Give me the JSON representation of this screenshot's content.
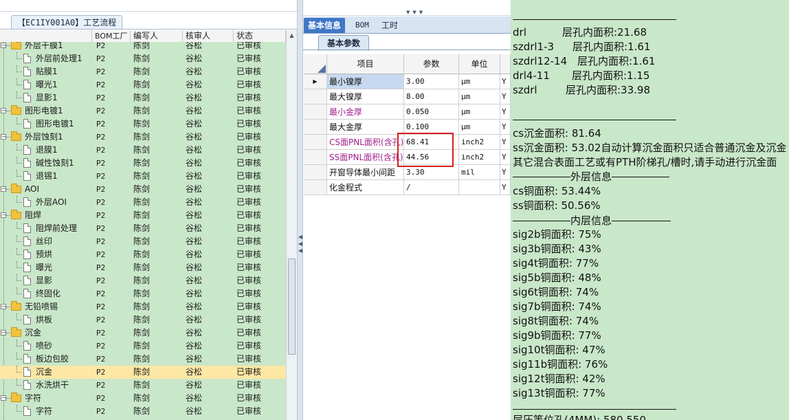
{
  "left_panel": {
    "tab_title": "【EC1IY001A0】工艺流程",
    "headers": {
      "bom": "BOM工厂",
      "writer": "编写人",
      "reviewer": "核审人",
      "status": "状态"
    },
    "rows": [
      {
        "kind": "group",
        "name": "外层干膜1",
        "bom": "P2",
        "writer": "陈剑",
        "reviewer": "谷松",
        "status": "已审核"
      },
      {
        "kind": "leaf",
        "name": "外层前处理1",
        "bom": "P2",
        "writer": "陈剑",
        "reviewer": "谷松",
        "status": "已审核"
      },
      {
        "kind": "leaf",
        "name": "贴膜1",
        "bom": "P2",
        "writer": "陈剑",
        "reviewer": "谷松",
        "status": "已审核"
      },
      {
        "kind": "leaf",
        "name": "曝光1",
        "bom": "P2",
        "writer": "陈剑",
        "reviewer": "谷松",
        "status": "已审核"
      },
      {
        "kind": "leaf",
        "name": "显影1",
        "bom": "P2",
        "writer": "陈剑",
        "reviewer": "谷松",
        "status": "已审核"
      },
      {
        "kind": "group",
        "name": "图形电镀1",
        "bom": "P2",
        "writer": "陈剑",
        "reviewer": "谷松",
        "status": "已审核"
      },
      {
        "kind": "leaf",
        "name": "图形电镀1",
        "bom": "P2",
        "writer": "陈剑",
        "reviewer": "谷松",
        "status": "已审核"
      },
      {
        "kind": "group",
        "name": "外层蚀刻1",
        "bom": "P2",
        "writer": "陈剑",
        "reviewer": "谷松",
        "status": "已审核"
      },
      {
        "kind": "leaf",
        "name": "退膜1",
        "bom": "P2",
        "writer": "陈剑",
        "reviewer": "谷松",
        "status": "已审核"
      },
      {
        "kind": "leaf",
        "name": "碱性蚀刻1",
        "bom": "P2",
        "writer": "陈剑",
        "reviewer": "谷松",
        "status": "已审核"
      },
      {
        "kind": "leaf",
        "name": "退锡1",
        "bom": "P2",
        "writer": "陈剑",
        "reviewer": "谷松",
        "status": "已审核"
      },
      {
        "kind": "group",
        "name": "AOI",
        "bom": "P2",
        "writer": "陈剑",
        "reviewer": "谷松",
        "status": "已审核"
      },
      {
        "kind": "leaf",
        "name": "外层AOI",
        "bom": "P2",
        "writer": "陈剑",
        "reviewer": "谷松",
        "status": "已审核"
      },
      {
        "kind": "group",
        "name": "阻焊",
        "bom": "P2",
        "writer": "陈剑",
        "reviewer": "谷松",
        "status": "已审核"
      },
      {
        "kind": "leaf",
        "name": "阻焊前处理",
        "bom": "P2",
        "writer": "陈剑",
        "reviewer": "谷松",
        "status": "已审核"
      },
      {
        "kind": "leaf",
        "name": "丝印",
        "bom": "P2",
        "writer": "陈剑",
        "reviewer": "谷松",
        "status": "已审核"
      },
      {
        "kind": "leaf",
        "name": "预烘",
        "bom": "P2",
        "writer": "陈剑",
        "reviewer": "谷松",
        "status": "已审核"
      },
      {
        "kind": "leaf",
        "name": "曝光",
        "bom": "P2",
        "writer": "陈剑",
        "reviewer": "谷松",
        "status": "已审核"
      },
      {
        "kind": "leaf",
        "name": "显影",
        "bom": "P2",
        "writer": "陈剑",
        "reviewer": "谷松",
        "status": "已审核"
      },
      {
        "kind": "leaf",
        "name": "终固化",
        "bom": "P2",
        "writer": "陈剑",
        "reviewer": "谷松",
        "status": "已审核"
      },
      {
        "kind": "group",
        "name": "无铅喷锡",
        "bom": "P2",
        "writer": "陈剑",
        "reviewer": "谷松",
        "status": "已审核"
      },
      {
        "kind": "leaf",
        "name": "烘板",
        "bom": "P2",
        "writer": "陈剑",
        "reviewer": "谷松",
        "status": "已审核"
      },
      {
        "kind": "group",
        "name": "沉金",
        "bom": "P2",
        "writer": "陈剑",
        "reviewer": "谷松",
        "status": "已审核"
      },
      {
        "kind": "leaf",
        "name": "喷砂",
        "bom": "P2",
        "writer": "陈剑",
        "reviewer": "谷松",
        "status": "已审核"
      },
      {
        "kind": "leaf",
        "name": "板边包胶",
        "bom": "P2",
        "writer": "陈剑",
        "reviewer": "谷松",
        "status": "已审核"
      },
      {
        "kind": "leaf",
        "name": "沉金",
        "bom": "P2",
        "writer": "陈剑",
        "reviewer": "谷松",
        "status": "已审核",
        "selected": true
      },
      {
        "kind": "leaf",
        "name": "水洗烘干",
        "bom": "P2",
        "writer": "陈剑",
        "reviewer": "谷松",
        "status": "已审核"
      },
      {
        "kind": "group",
        "name": "字符",
        "bom": "P2",
        "writer": "陈剑",
        "reviewer": "谷松",
        "status": "已审核"
      },
      {
        "kind": "leaf",
        "name": "字符",
        "bom": "P2",
        "writer": "陈剑",
        "reviewer": "谷松",
        "status": "已审核"
      }
    ]
  },
  "mid_panel": {
    "tabs": [
      "基本信息",
      "BOM",
      "工时"
    ],
    "sub_tab": "基本参数",
    "headers": {
      "item": "项目",
      "param": "参数",
      "unit": "单位"
    },
    "rows": [
      {
        "name": "最小镍厚",
        "value": "3.00",
        "unit": "μm",
        "last": "Y",
        "style": "hl",
        "current": true
      },
      {
        "name": "最大镍厚",
        "value": "8.00",
        "unit": "μm",
        "last": "Y",
        "style": ""
      },
      {
        "name": "最小金厚",
        "value": "0.050",
        "unit": "μm",
        "last": "Y",
        "style": "pink"
      },
      {
        "name": "最大金厚",
        "value": "0.100",
        "unit": "μm",
        "last": "Y",
        "style": ""
      },
      {
        "name": "CS面PNL面积(含孔)",
        "value": "68.41",
        "unit": "inch2",
        "last": "Y",
        "style": "pink"
      },
      {
        "name": "SS面PNL面积(含孔)",
        "value": "44.56",
        "unit": "inch2",
        "last": "Y",
        "style": "pink"
      },
      {
        "name": "开窗导体最小间距",
        "value": "3.30",
        "unit": "mil",
        "last": "Y",
        "style": ""
      },
      {
        "name": "化金程式",
        "value": "/",
        "unit": "",
        "last": "Y",
        "style": ""
      }
    ]
  },
  "right_panel": {
    "hole_lines": [
      {
        "layer": "drl",
        "text": "层孔内面积:21.68"
      },
      {
        "layer": "szdrl1-3",
        "text": "层孔内面积:1.61"
      },
      {
        "layer": "szdrl12-14",
        "text": "层孔内面积:1.61"
      },
      {
        "layer": "drl4-11",
        "text": "层孔内面积:1.15"
      },
      {
        "layer": "szdrl",
        "text": "层孔内面积:33.98"
      }
    ],
    "cs_gold": "cs沉金面积: 81.64",
    "ss_gold": "ss沉金面积: 53.02自动计算沉金面积只适合普通沉金及沉金",
    "note": "其它混合表面工艺或有PTH阶梯孔/槽时,请手动进行沉金面",
    "outer_title": "外层信息",
    "cs_copper": "cs铜面积: 53.44%",
    "ss_copper": "ss铜面积: 50.56%",
    "inner_title": "内层信息",
    "inner_lines": [
      "sig2b铜面积: 75%",
      "sig3b铜面积: 43%",
      "sig4t铜面积: 77%",
      "sig5b铜面积: 48%",
      "sig6t铜面积: 74%",
      "sig7b铜面积: 74%",
      "sig8t铜面积: 74%",
      "sig9b铜面积: 77%",
      "sig10t铜面积: 47%",
      "sig11b铜面积: 76%",
      "sig12t铜面积: 42%",
      "sig13t铜面积: 77%"
    ],
    "cut_line": "层压等位孔(4MM): 580.550"
  }
}
